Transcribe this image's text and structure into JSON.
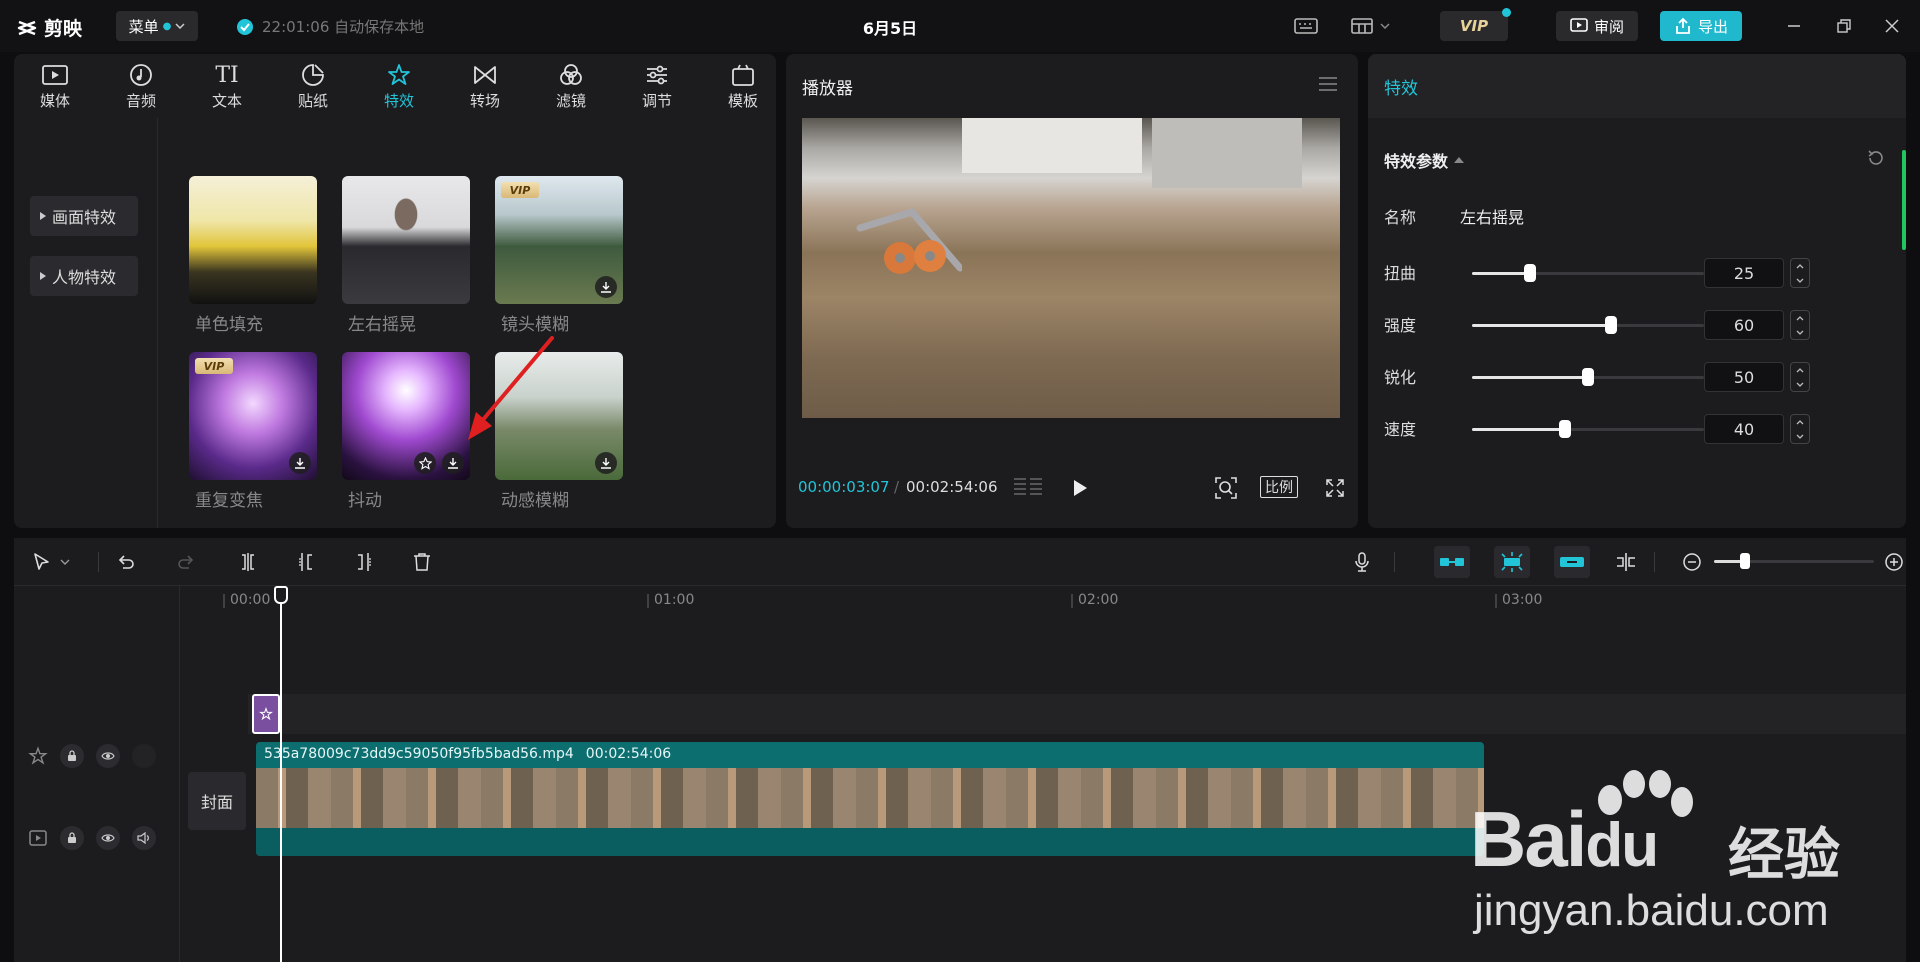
{
  "app": {
    "logo_text": "剪映",
    "menu_label": "菜单",
    "autosave_text": "22:01:06 自动保存本地",
    "project_title": "6月5日",
    "vip_label": "VIP",
    "review_label": "审阅",
    "export_label": "导出"
  },
  "tabs": [
    {
      "label": "媒体",
      "icon": "media-icon"
    },
    {
      "label": "音频",
      "icon": "audio-icon"
    },
    {
      "label": "文本",
      "icon": "text-icon"
    },
    {
      "label": "贴纸",
      "icon": "sticker-icon"
    },
    {
      "label": "特效",
      "icon": "effects-icon",
      "active": true
    },
    {
      "label": "转场",
      "icon": "transition-icon"
    },
    {
      "label": "滤镜",
      "icon": "filter-icon"
    },
    {
      "label": "调节",
      "icon": "adjust-icon"
    },
    {
      "label": "模板",
      "icon": "template-icon"
    }
  ],
  "categories": [
    "画面特效",
    "人物特效"
  ],
  "effects": [
    {
      "label": "单色填充",
      "vip": false,
      "download": false
    },
    {
      "label": "左右摇晃",
      "vip": false,
      "download": false
    },
    {
      "label": "镜头模糊",
      "vip": true,
      "download": true
    },
    {
      "label": "重复变焦",
      "vip": true,
      "download": true
    },
    {
      "label": "抖动",
      "vip": false,
      "download": true,
      "favorite": true
    },
    {
      "label": "动感模糊",
      "vip": false,
      "download": true
    }
  ],
  "vip_tag": "VIP",
  "player": {
    "title": "播放器",
    "current_time": "00:00:03:07",
    "separator": "/",
    "total_time": "00:02:54:06",
    "ratio_label": "比例"
  },
  "fx": {
    "title": "特效",
    "section_title": "特效参数",
    "name_label": "名称",
    "name_value": "左右摇晃",
    "params": [
      {
        "label": "扭曲",
        "value": 25
      },
      {
        "label": "强度",
        "value": 60
      },
      {
        "label": "锐化",
        "value": 50
      },
      {
        "label": "速度",
        "value": 40
      }
    ]
  },
  "timeline": {
    "ruler": [
      "00:00",
      "01:00",
      "02:00",
      "03:00"
    ],
    "clip_name": "535a78009c73dd9c59050f95fb5bad56.mp4",
    "clip_duration": "00:02:54:06",
    "cover_label": "封面"
  },
  "watermark": {
    "logo_text": "Bai",
    "logo_text2": "du",
    "cn": "经验",
    "url": "jingyan.baidu.com"
  },
  "colors": {
    "accent": "#22c5d8",
    "export": "#1fb8cc",
    "clip": "#0d6e70",
    "effect_clip": "#7a4fa0"
  }
}
